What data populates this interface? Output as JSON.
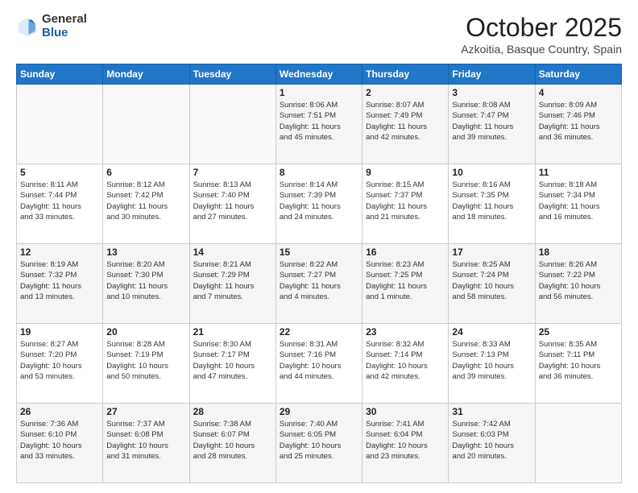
{
  "header": {
    "logo_general": "General",
    "logo_blue": "Blue",
    "month": "October 2025",
    "location": "Azkoitia, Basque Country, Spain"
  },
  "weekdays": [
    "Sunday",
    "Monday",
    "Tuesday",
    "Wednesday",
    "Thursday",
    "Friday",
    "Saturday"
  ],
  "weeks": [
    [
      {
        "day": "",
        "info": ""
      },
      {
        "day": "",
        "info": ""
      },
      {
        "day": "",
        "info": ""
      },
      {
        "day": "1",
        "info": "Sunrise: 8:06 AM\nSunset: 7:51 PM\nDaylight: 11 hours\nand 45 minutes."
      },
      {
        "day": "2",
        "info": "Sunrise: 8:07 AM\nSunset: 7:49 PM\nDaylight: 11 hours\nand 42 minutes."
      },
      {
        "day": "3",
        "info": "Sunrise: 8:08 AM\nSunset: 7:47 PM\nDaylight: 11 hours\nand 39 minutes."
      },
      {
        "day": "4",
        "info": "Sunrise: 8:09 AM\nSunset: 7:46 PM\nDaylight: 11 hours\nand 36 minutes."
      }
    ],
    [
      {
        "day": "5",
        "info": "Sunrise: 8:11 AM\nSunset: 7:44 PM\nDaylight: 11 hours\nand 33 minutes."
      },
      {
        "day": "6",
        "info": "Sunrise: 8:12 AM\nSunset: 7:42 PM\nDaylight: 11 hours\nand 30 minutes."
      },
      {
        "day": "7",
        "info": "Sunrise: 8:13 AM\nSunset: 7:40 PM\nDaylight: 11 hours\nand 27 minutes."
      },
      {
        "day": "8",
        "info": "Sunrise: 8:14 AM\nSunset: 7:39 PM\nDaylight: 11 hours\nand 24 minutes."
      },
      {
        "day": "9",
        "info": "Sunrise: 8:15 AM\nSunset: 7:37 PM\nDaylight: 11 hours\nand 21 minutes."
      },
      {
        "day": "10",
        "info": "Sunrise: 8:16 AM\nSunset: 7:35 PM\nDaylight: 11 hours\nand 18 minutes."
      },
      {
        "day": "11",
        "info": "Sunrise: 8:18 AM\nSunset: 7:34 PM\nDaylight: 11 hours\nand 16 minutes."
      }
    ],
    [
      {
        "day": "12",
        "info": "Sunrise: 8:19 AM\nSunset: 7:32 PM\nDaylight: 11 hours\nand 13 minutes."
      },
      {
        "day": "13",
        "info": "Sunrise: 8:20 AM\nSunset: 7:30 PM\nDaylight: 11 hours\nand 10 minutes."
      },
      {
        "day": "14",
        "info": "Sunrise: 8:21 AM\nSunset: 7:29 PM\nDaylight: 11 hours\nand 7 minutes."
      },
      {
        "day": "15",
        "info": "Sunrise: 8:22 AM\nSunset: 7:27 PM\nDaylight: 11 hours\nand 4 minutes."
      },
      {
        "day": "16",
        "info": "Sunrise: 8:23 AM\nSunset: 7:25 PM\nDaylight: 11 hours\nand 1 minute."
      },
      {
        "day": "17",
        "info": "Sunrise: 8:25 AM\nSunset: 7:24 PM\nDaylight: 10 hours\nand 58 minutes."
      },
      {
        "day": "18",
        "info": "Sunrise: 8:26 AM\nSunset: 7:22 PM\nDaylight: 10 hours\nand 56 minutes."
      }
    ],
    [
      {
        "day": "19",
        "info": "Sunrise: 8:27 AM\nSunset: 7:20 PM\nDaylight: 10 hours\nand 53 minutes."
      },
      {
        "day": "20",
        "info": "Sunrise: 8:28 AM\nSunset: 7:19 PM\nDaylight: 10 hours\nand 50 minutes."
      },
      {
        "day": "21",
        "info": "Sunrise: 8:30 AM\nSunset: 7:17 PM\nDaylight: 10 hours\nand 47 minutes."
      },
      {
        "day": "22",
        "info": "Sunrise: 8:31 AM\nSunset: 7:16 PM\nDaylight: 10 hours\nand 44 minutes."
      },
      {
        "day": "23",
        "info": "Sunrise: 8:32 AM\nSunset: 7:14 PM\nDaylight: 10 hours\nand 42 minutes."
      },
      {
        "day": "24",
        "info": "Sunrise: 8:33 AM\nSunset: 7:13 PM\nDaylight: 10 hours\nand 39 minutes."
      },
      {
        "day": "25",
        "info": "Sunrise: 8:35 AM\nSunset: 7:11 PM\nDaylight: 10 hours\nand 36 minutes."
      }
    ],
    [
      {
        "day": "26",
        "info": "Sunrise: 7:36 AM\nSunset: 6:10 PM\nDaylight: 10 hours\nand 33 minutes."
      },
      {
        "day": "27",
        "info": "Sunrise: 7:37 AM\nSunset: 6:08 PM\nDaylight: 10 hours\nand 31 minutes."
      },
      {
        "day": "28",
        "info": "Sunrise: 7:38 AM\nSunset: 6:07 PM\nDaylight: 10 hours\nand 28 minutes."
      },
      {
        "day": "29",
        "info": "Sunrise: 7:40 AM\nSunset: 6:05 PM\nDaylight: 10 hours\nand 25 minutes."
      },
      {
        "day": "30",
        "info": "Sunrise: 7:41 AM\nSunset: 6:04 PM\nDaylight: 10 hours\nand 23 minutes."
      },
      {
        "day": "31",
        "info": "Sunrise: 7:42 AM\nSunset: 6:03 PM\nDaylight: 10 hours\nand 20 minutes."
      },
      {
        "day": "",
        "info": ""
      }
    ]
  ]
}
